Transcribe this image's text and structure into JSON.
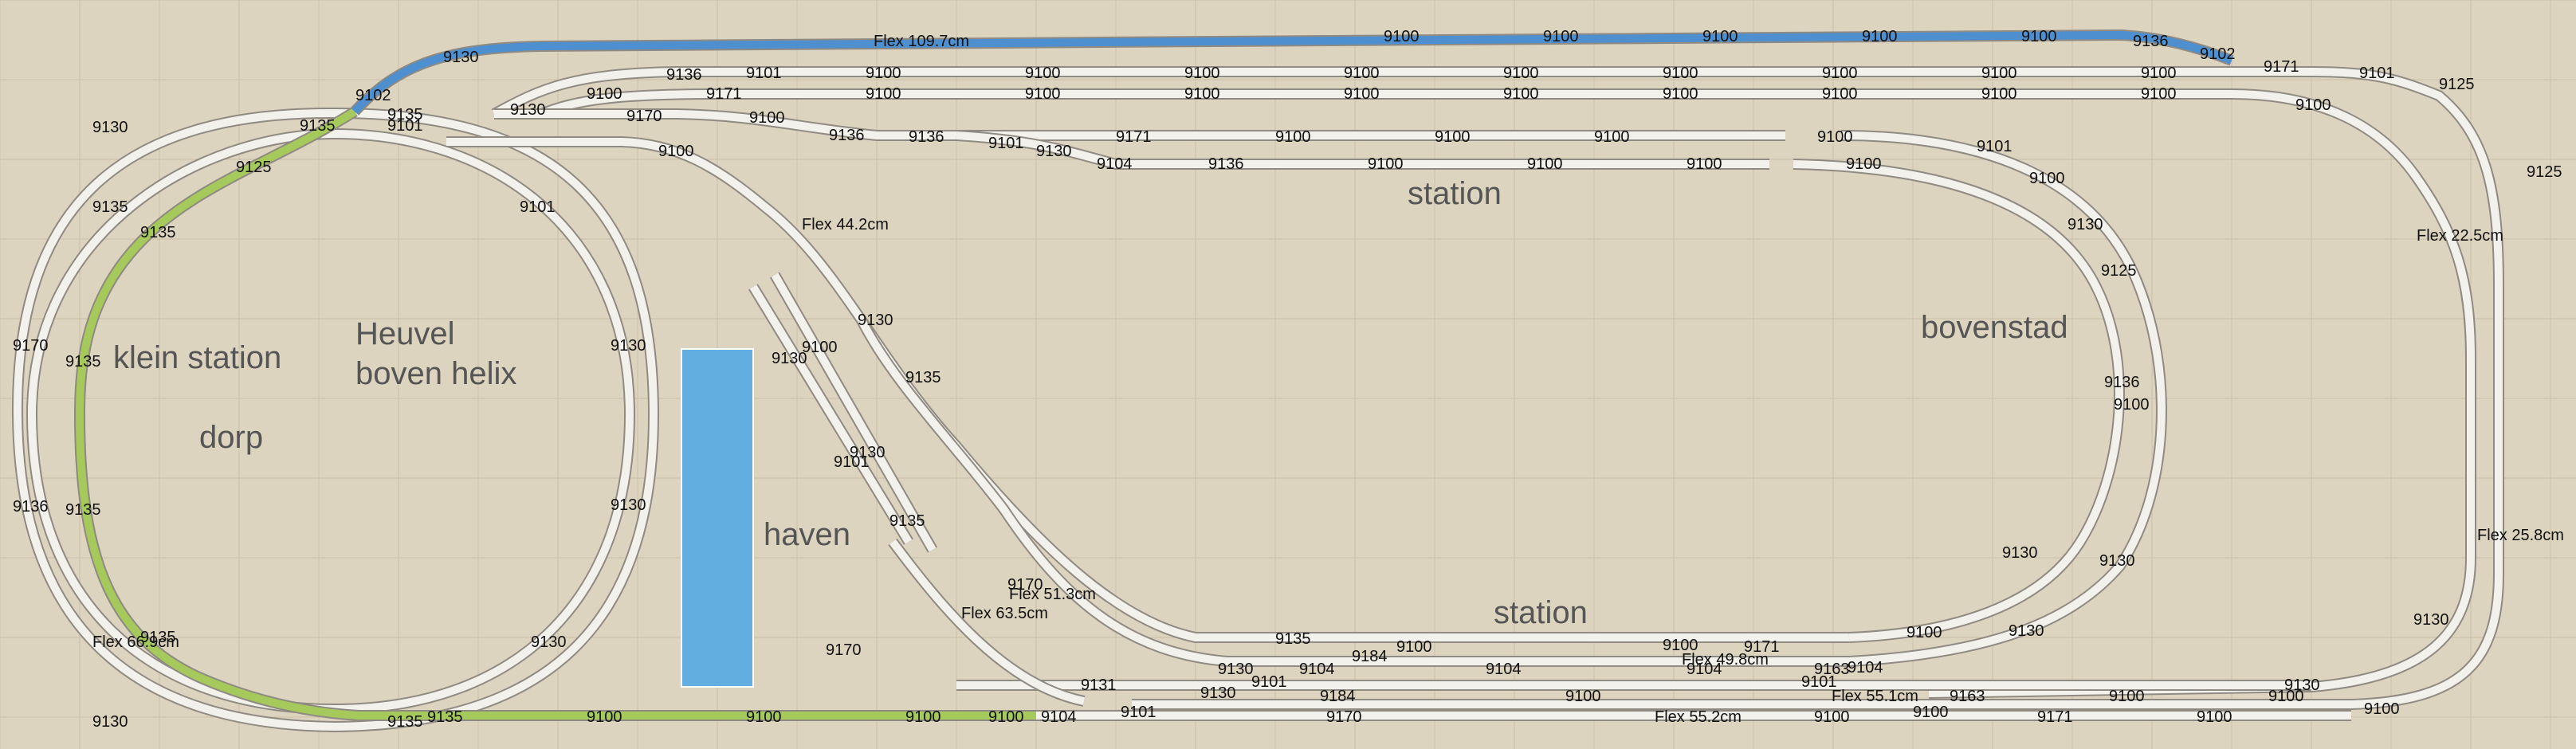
{
  "areas": {
    "klein_station": "klein station",
    "dorp": "dorp",
    "heuvel_1": "Heuvel",
    "heuvel_2": "boven helix",
    "haven": "haven",
    "station_top": "station",
    "station_bottom": "station",
    "bovenstad": "bovenstad"
  },
  "colors": {
    "background": "#ddd4c0",
    "grid": "#cbc0a8",
    "rail_fill": "#f3f1ec",
    "rail_edge": "#8f8a82",
    "green_track": "#a5c95a",
    "blue_track": "#4e8fd0",
    "water": "#62aee1"
  },
  "labels": [
    "Flex 109.7cm",
    "9100",
    "9100",
    "9100",
    "9100",
    "9100",
    "9136",
    "9102",
    "9171",
    "9101",
    "9125",
    "9130",
    "9102",
    "9136",
    "9101",
    "9100",
    "9100",
    "9100",
    "9100",
    "9100",
    "9100",
    "9100",
    "9100",
    "9100",
    "9100",
    "9171",
    "9100",
    "9100",
    "9100",
    "9100",
    "9100",
    "9100",
    "9100",
    "9100",
    "9100",
    "9100",
    "9130",
    "9170",
    "9100",
    "9136",
    "9136",
    "9101",
    "9171",
    "9100",
    "9100",
    "9100",
    "9100",
    "9101",
    "9130",
    "9135",
    "9101",
    "9135",
    "9100",
    "9130",
    "9104",
    "9136",
    "9100",
    "9100",
    "9100",
    "9100",
    "9100",
    "9125",
    "9125",
    "9101",
    "9135",
    "9135",
    "9130",
    "Flex 22.5cm",
    "Flex 44.2cm",
    "9130",
    "9170",
    "9135",
    "9130",
    "9135",
    "9136",
    "9130",
    "9100",
    "9100",
    "9125",
    "9130",
    "9101",
    "9136",
    "9135",
    "9130",
    "9130",
    "9135",
    "9170",
    "Flex 51.3cm",
    "Flex 63.5cm",
    "9130",
    "Flex 25.8cm",
    "Flex 66.9cm",
    "9135",
    "9130",
    "9135",
    "9100",
    "9170",
    "9100",
    "9171",
    "9100",
    "9130",
    "9130",
    "9130",
    "9101",
    "9104",
    "9184",
    "9104",
    "Flex 49.8cm",
    "9104",
    "9163",
    "9101",
    "9104",
    "9131",
    "9130",
    "9130",
    "9184",
    "9100",
    "Flex 55.1cm",
    "9163",
    "9100",
    "9100",
    "9130",
    "9135",
    "9135",
    "9100",
    "9100",
    "9100",
    "9100",
    "9104",
    "9101",
    "9170",
    "Flex 55.2cm",
    "9100",
    "9100",
    "9171",
    "9100",
    "9100",
    "9130"
  ]
}
